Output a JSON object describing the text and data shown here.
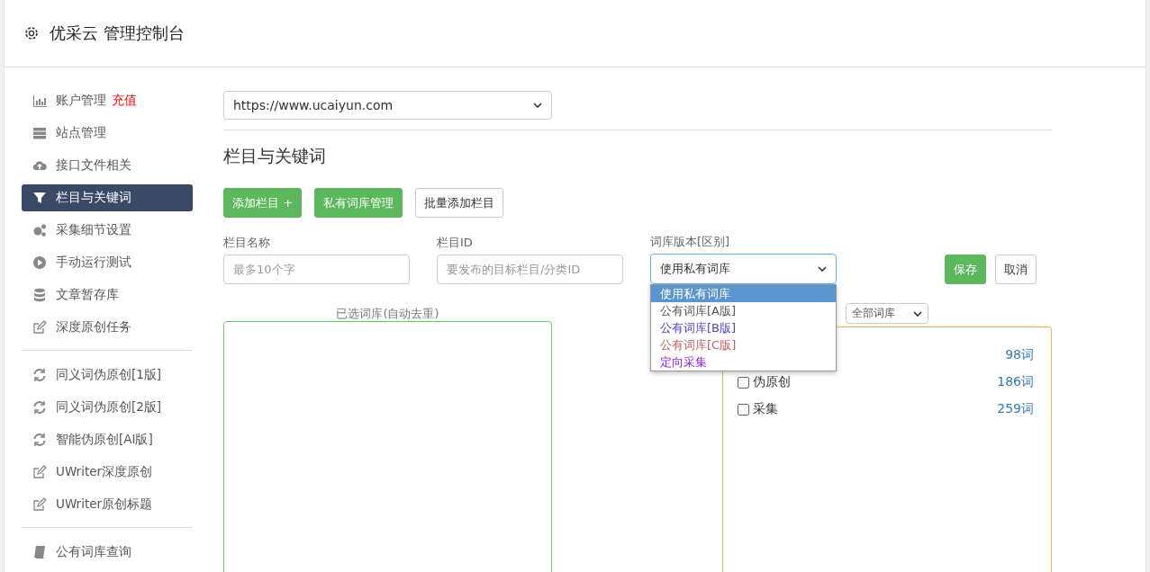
{
  "header": {
    "title": "优采云 管理控制台"
  },
  "sidebar": {
    "groups": [
      {
        "items": [
          {
            "label": "账户管理",
            "badge": "充值",
            "selected": false
          },
          {
            "label": "站点管理",
            "selected": false
          },
          {
            "label": "接口文件相关",
            "selected": false
          },
          {
            "label": "栏目与关键词",
            "selected": true
          },
          {
            "label": "采集细节设置",
            "selected": false
          },
          {
            "label": "手动运行测试",
            "selected": false
          },
          {
            "label": "文章暂存库",
            "selected": false
          },
          {
            "label": "深度原创任务",
            "selected": false
          }
        ]
      },
      {
        "items": [
          {
            "label": "同义词伪原创[1版]",
            "selected": false
          },
          {
            "label": "同义词伪原创[2版]",
            "selected": false
          },
          {
            "label": "智能伪原创[AI版]",
            "selected": false
          },
          {
            "label": "UWriter深度原创",
            "selected": false
          },
          {
            "label": "UWriter原创标题",
            "selected": false
          }
        ]
      },
      {
        "items": [
          {
            "label": "公有词库查询",
            "selected": false
          }
        ]
      }
    ]
  },
  "site_select": {
    "value": "https://www.ucaiyun.com"
  },
  "heading": "栏目与关键词",
  "toolbar": [
    {
      "label": "添加栏目 +",
      "kind": "primary"
    },
    {
      "label": "私有词库管理",
      "kind": "primary"
    },
    {
      "label": "批量添加栏目",
      "kind": "default"
    }
  ],
  "form": {
    "fields": [
      {
        "label": "栏目名称",
        "placeholder": "最多10个字"
      },
      {
        "label": "栏目ID",
        "placeholder": "要发布的目标栏目/分类ID"
      }
    ],
    "version": {
      "label": "词库版本[区别]",
      "value": "使用私有词库",
      "expanded": true,
      "options": [
        {
          "label": "使用私有词库",
          "selected": true,
          "color": "#ffffff"
        },
        {
          "label": "公有词库[A版]",
          "selected": false,
          "color": "#555555"
        },
        {
          "label": "公有词库[B版]",
          "selected": false,
          "color": "#4b3fd6"
        },
        {
          "label": "公有词库[C版]",
          "selected": false,
          "color": "#c06060"
        },
        {
          "label": "定向采集",
          "selected": false,
          "color": "#8b1cf0"
        }
      ]
    },
    "save": "保存",
    "cancel": "取消"
  },
  "selected_box": {
    "label": "已选词库(自动去重)"
  },
  "library_filter": {
    "value": "全部词库"
  },
  "libraries": [
    {
      "count": "98词"
    },
    {
      "name": "伪原创",
      "count": "186词",
      "checked": false
    },
    {
      "name": "采集",
      "count": "259词",
      "checked": false
    }
  ]
}
